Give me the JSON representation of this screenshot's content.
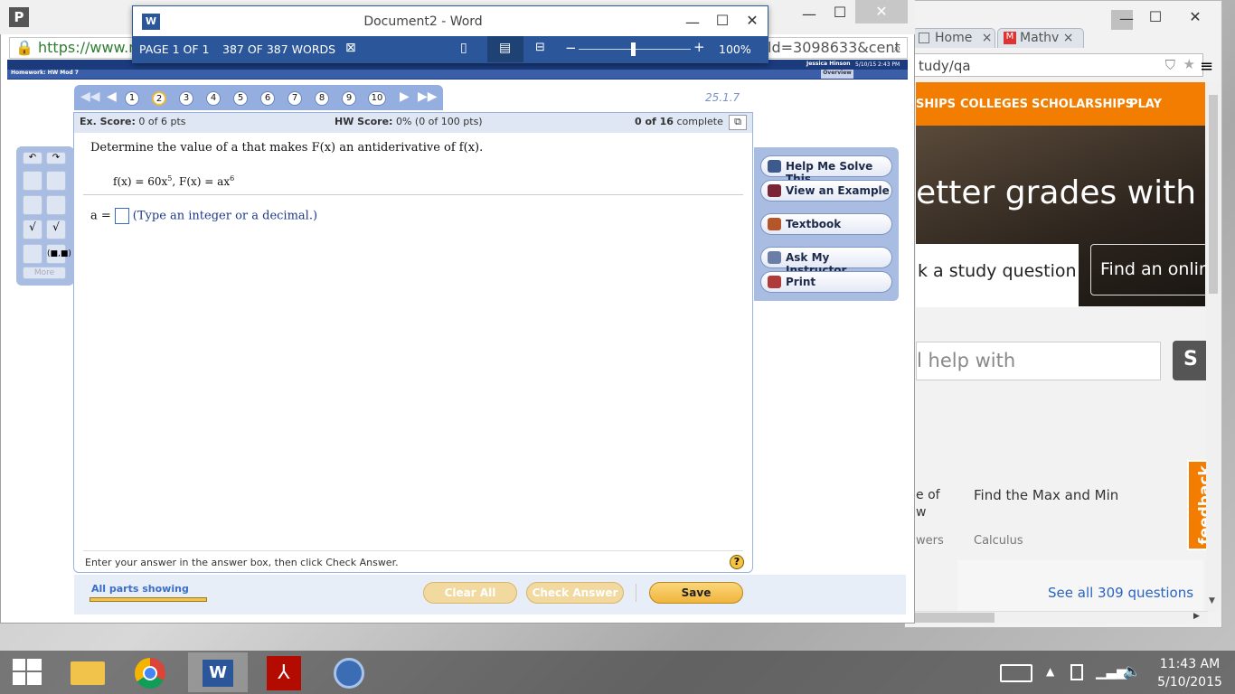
{
  "word": {
    "title": "Document2 - Word",
    "page": "PAGE 1 OF 1",
    "words": "387 OF 387 WORDS",
    "zoom": "100%"
  },
  "browser1": {
    "url": "https://www.ma",
    "url_tail": "ld=3098633&cent",
    "user": "Jessica Hinson",
    "datetime": "5/10/15 2:43 PM",
    "subbar": "Homework:  HW Mod 7",
    "overview": "Overview"
  },
  "question": {
    "nums": [
      "1",
      "2",
      "3",
      "4",
      "5",
      "6",
      "7",
      "8",
      "9",
      "10"
    ],
    "version": "25.1.7",
    "ex_score_label": "Ex. Score:",
    "ex_score": "0 of 6 pts",
    "hw_score_label": "HW Score:",
    "hw_score": "0% (0 of 100 pts)",
    "complete_count": "0 of 16",
    "complete_word": "complete",
    "prompt": "Determine the value of a that makes F(x) an antiderivative of f(x).",
    "fx": "f(x) = 60x",
    "fx_exp": "5",
    "Fx": ", F(x) = ax",
    "Fx_exp": "6",
    "ans_label": "a =",
    "ans_hint": "(Type an integer or a decimal.)",
    "bottom_hint": "Enter your answer in the answer box, then click Check Answer.",
    "help": "?",
    "all_parts": "All parts showing"
  },
  "tools": {
    "more": "More"
  },
  "side": {
    "help": "Help Me Solve This",
    "example": "View an Example",
    "textbook": "Textbook",
    "ask": "Ask My Instructor",
    "print": "Print"
  },
  "actions": {
    "clear": "Clear All",
    "check": "Check Answer",
    "save": "Save"
  },
  "browser2": {
    "tab1": "Home",
    "tab2": "Mathv",
    "url": "tudy/qa",
    "nav": [
      "SHIPS",
      "COLLEGES",
      "SCHOLARSHIPS",
      "PLAY"
    ],
    "hero": "etter grades with C",
    "study": "k a study question",
    "find": "Find an onlin",
    "search": "l help with",
    "sbtn": "S",
    "card1a": "e of",
    "card1b": "w",
    "card1c": "wers",
    "card2": "Find the Max and Min",
    "card2sub": "Calculus",
    "feedback": "feedback",
    "seeall": "See all 309 questions"
  },
  "taskbar": {
    "time": "11:43 AM",
    "date": "5/10/2015"
  }
}
